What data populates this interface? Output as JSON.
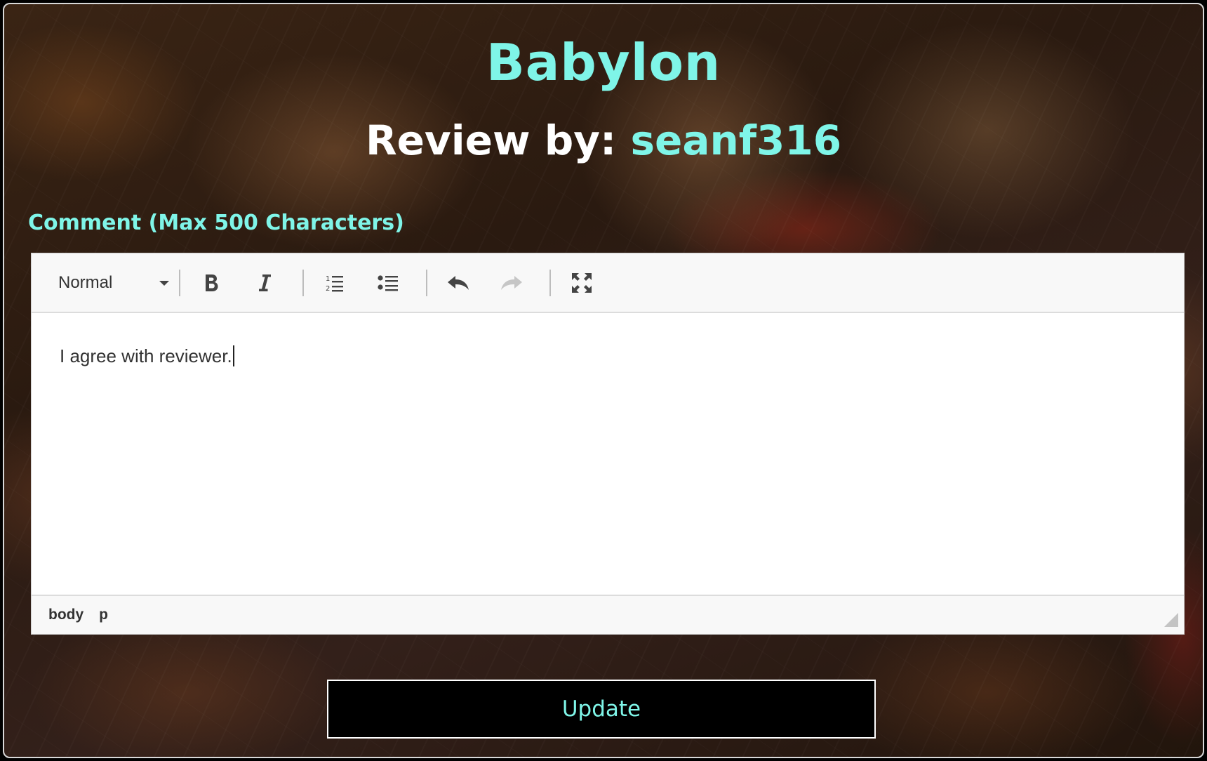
{
  "page": {
    "movie_title": "Babylon",
    "review_by_prefix": "Review by: ",
    "reviewer_username": "seanf316",
    "comment_label": "Comment (Max 500 Characters)"
  },
  "editor": {
    "format_select_value": "Normal",
    "toolbar_icons": [
      "bold-icon",
      "italic-icon",
      "ordered-list-icon",
      "bullet-list-icon",
      "undo-icon",
      "redo-icon",
      "fullscreen-icon"
    ],
    "content_text": "I agree with reviewer.",
    "statusbar_path": [
      "body",
      "p"
    ]
  },
  "actions": {
    "update_label": "Update"
  },
  "colors": {
    "accent": "#7ff5e8",
    "button_bg": "#000000",
    "editor_bg": "#ffffff",
    "toolbar_bg": "#f8f8f8"
  }
}
